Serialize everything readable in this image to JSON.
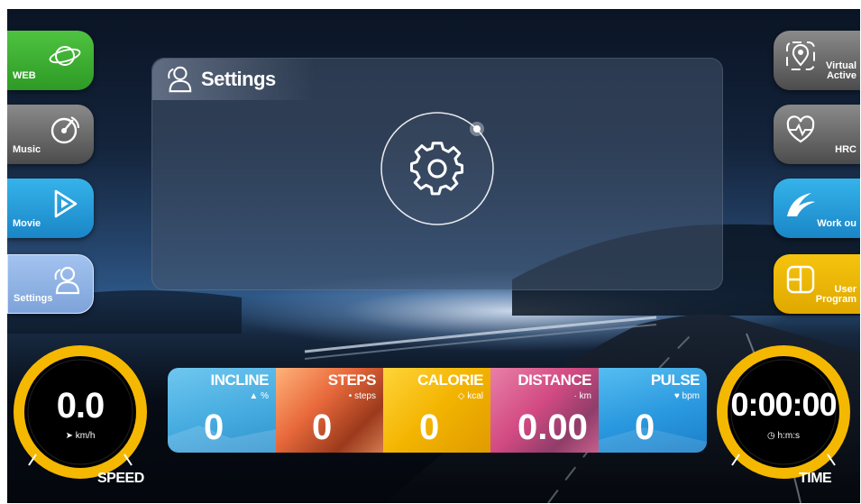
{
  "left_menu": [
    {
      "label": "WEB",
      "icon": "globe-icon"
    },
    {
      "label": "Music",
      "icon": "music-disc-icon"
    },
    {
      "label": "Movie",
      "icon": "play-icon"
    },
    {
      "label": "Settings",
      "icon": "users-icon"
    }
  ],
  "right_menu": [
    {
      "label_line1": "Virtual",
      "label_line2": "Active",
      "icon": "location-pin-icon"
    },
    {
      "label_line1": "HRC",
      "label_line2": "",
      "icon": "heart-pulse-icon"
    },
    {
      "label_line1": "Work ou",
      "label_line2": "",
      "icon": "wave-icon"
    },
    {
      "label_line1": "User",
      "label_line2": "Program",
      "icon": "grid-icon"
    }
  ],
  "panel": {
    "title": "Settings",
    "title_icon": "users-icon",
    "center_icon": "gear-icon"
  },
  "stats": [
    {
      "name": "INCLINE",
      "unit": "%",
      "value": "0",
      "icon": "mountain-icon"
    },
    {
      "name": "STEPS",
      "unit": "steps",
      "value": "0",
      "icon": "footprint-icon"
    },
    {
      "name": "CALORIE",
      "unit": "kcal",
      "value": "0",
      "icon": "flame-icon"
    },
    {
      "name": "DISTANCE",
      "unit": "km",
      "value": "0.00",
      "icon": "route-icon"
    },
    {
      "name": "PULSE",
      "unit": "bpm",
      "value": "0",
      "icon": "heart-icon"
    }
  ],
  "speed": {
    "value": "0.0",
    "unit": "km/h",
    "label": "SPEED"
  },
  "time": {
    "value": "0:00:00",
    "unit": "h:m:s",
    "label": "TIME"
  },
  "colors": {
    "web": "#3cb134",
    "gray_tile": "#6a6a6a",
    "blue_tile": "#2a9ad8",
    "settings_tile": "#8fb2e6",
    "yellow_tile": "#f0b800",
    "dial_ring": "#f5b800"
  }
}
